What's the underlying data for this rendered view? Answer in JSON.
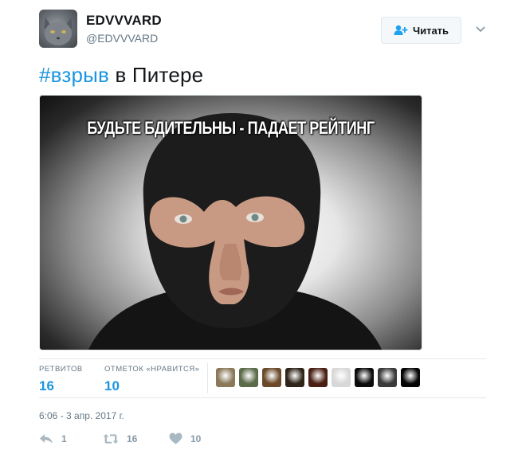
{
  "author": {
    "fullname": "EDVVVARD",
    "handle": "@EDVVVARD"
  },
  "follow_button": {
    "label": "Читать"
  },
  "tweet": {
    "hashtag": "#взрыв",
    "text_rest": " в Питере"
  },
  "media": {
    "caption": "БУДЬТЕ БДИТЕЛЬНЫ - ПАДАЕТ РЕЙТИНГ"
  },
  "stats": {
    "retweets": {
      "label": "РЕТВИТОВ",
      "value": "16"
    },
    "likes": {
      "label": "ОТМЕТОК «НРАВИТСЯ»",
      "value": "10"
    }
  },
  "likers": [
    {
      "color": "#8a7a5a"
    },
    {
      "color": "#5c6b4a"
    },
    {
      "color": "#6a4a2a"
    },
    {
      "color": "#2e2418"
    },
    {
      "color": "#4a1f14"
    },
    {
      "color": "#d8d8d8"
    },
    {
      "color": "#0c0c0c"
    },
    {
      "color": "#3a3a3a"
    },
    {
      "color": "#050505"
    }
  ],
  "timestamp": "6:06 - 3 апр. 2017 г.",
  "actions": {
    "reply": {
      "icon": "reply-icon",
      "count": "1"
    },
    "retweet": {
      "icon": "retweet-icon",
      "count": "16"
    },
    "like": {
      "icon": "heart-icon",
      "count": "10"
    }
  },
  "colors": {
    "link": "#1b95e0",
    "muted": "#657786",
    "action": "#8899a6"
  }
}
